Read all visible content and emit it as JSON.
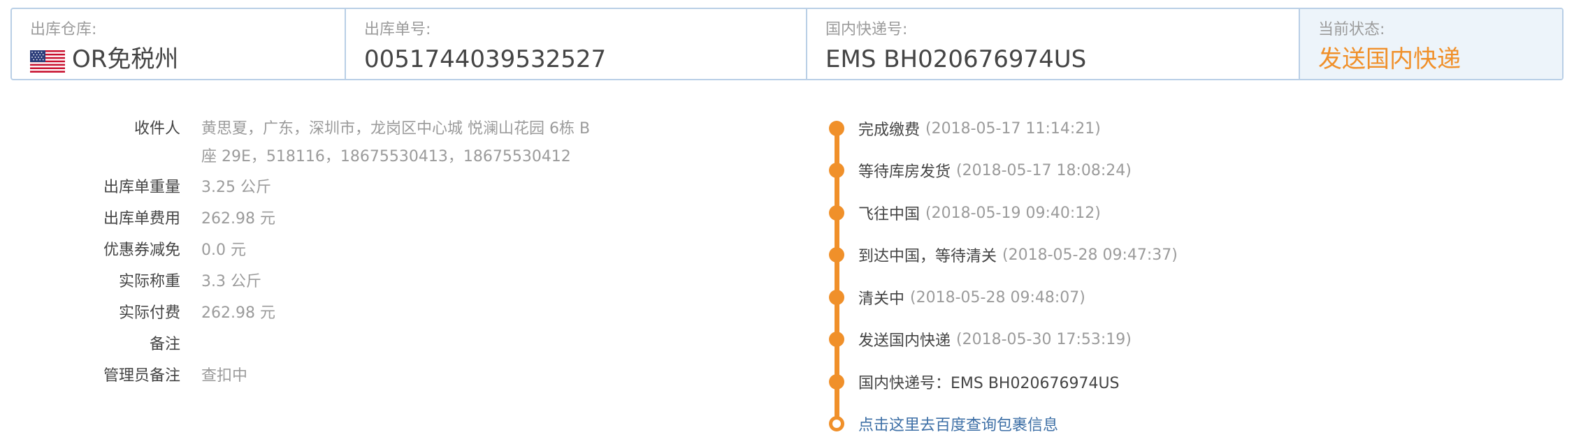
{
  "header": {
    "warehouse_label": "出库仓库:",
    "warehouse_value": "OR免税州",
    "warehouse_flag": "us-flag-icon",
    "order_no_label": "出库单号:",
    "order_no_value": "0051744039532527",
    "tracking_label": "国内快递号:",
    "tracking_value": "EMS BH020676974US",
    "status_label": "当前状态:",
    "status_value": "发送国内快递"
  },
  "details": {
    "recipient_label": "收件人",
    "recipient_line1": "黄思夏，广东，深圳市，龙岗区中心城 悦澜山花园 6栋 B",
    "recipient_line2": "座 29E，518116，18675530413，18675530412",
    "weight_label": "出库单重量",
    "weight_value": "3.25 公斤",
    "fee_label": "出库单费用",
    "fee_value": "262.98 元",
    "coupon_label": "优惠券减免",
    "coupon_value": "0.0 元",
    "actual_weight_label": "实际称重",
    "actual_weight_value": "3.3 公斤",
    "actual_paid_label": "实际付费",
    "actual_paid_value": "262.98 元",
    "remark_label": "备注",
    "remark_value": "",
    "admin_remark_label": "管理员备注",
    "admin_remark_value": "查扣中"
  },
  "timeline": {
    "events": [
      {
        "text": "完成缴费",
        "time": "(2018-05-17 11:14:21)"
      },
      {
        "text": "等待库房发货",
        "time": "(2018-05-17 18:08:24)"
      },
      {
        "text": "飞往中国",
        "time": "(2018-05-19 09:40:12)"
      },
      {
        "text": "到达中国，等待清关",
        "time": "(2018-05-28 09:47:37)"
      },
      {
        "text": "清关中",
        "time": "(2018-05-28 09:48:07)"
      },
      {
        "text": "发送国内快递",
        "time": "(2018-05-30 17:53:19)"
      },
      {
        "text": "国内快递号：EMS BH020676974US",
        "time": ""
      }
    ],
    "link_text": "点击这里去百度查询包裹信息"
  },
  "colors": {
    "accent": "#f0902a",
    "border": "#b9cfe6",
    "status_bg": "#edf4fa",
    "link": "#3d6fa6"
  }
}
